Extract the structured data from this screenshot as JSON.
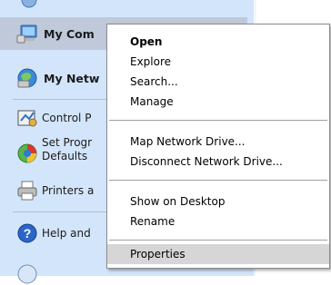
{
  "sidebar": {
    "items": [
      {
        "label": "My Com",
        "icon": "my-computer-icon"
      },
      {
        "label": "My Netw",
        "icon": "my-network-icon"
      },
      {
        "label": "Control P",
        "icon": "control-panel-icon"
      },
      {
        "label": "Set Progr",
        "label2": "Defaults",
        "icon": "set-program-defaults-icon"
      },
      {
        "label": "Printers a",
        "icon": "printers-icon"
      },
      {
        "label": "Help and",
        "icon": "help-icon"
      }
    ]
  },
  "context_menu": {
    "items": [
      {
        "label": "Open",
        "bold": true
      },
      {
        "label": "Explore"
      },
      {
        "label": "Search..."
      },
      {
        "label": "Manage"
      },
      {
        "label": "Map Network Drive..."
      },
      {
        "label": "Disconnect Network Drive..."
      },
      {
        "label": "Show on Desktop"
      },
      {
        "label": "Rename"
      },
      {
        "label": "Properties"
      }
    ]
  }
}
